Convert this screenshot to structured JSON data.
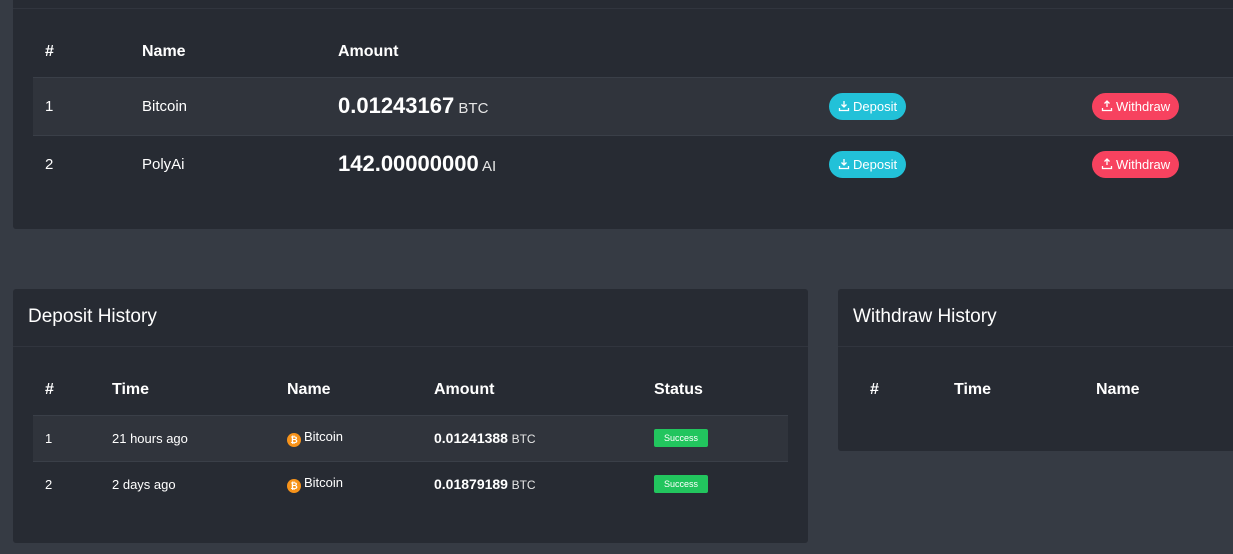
{
  "wallet": {
    "headers": {
      "num": "#",
      "name": "Name",
      "amount": "Amount"
    },
    "rows": [
      {
        "num": "1",
        "name": "Bitcoin",
        "amount": "0.01243167",
        "unit": "BTC",
        "deposit_label": "Deposit",
        "withdraw_label": "Withdraw"
      },
      {
        "num": "2",
        "name": "PolyAi",
        "amount": "142.00000000",
        "unit": "AI",
        "deposit_label": "Deposit",
        "withdraw_label": "Withdraw"
      }
    ],
    "icons": {
      "deposit": "download-icon",
      "withdraw": "upload-icon"
    }
  },
  "deposit_history": {
    "title": "Deposit History",
    "headers": {
      "num": "#",
      "time": "Time",
      "name": "Name",
      "amount": "Amount",
      "status": "Status"
    },
    "rows": [
      {
        "num": "1",
        "time": "21 hours ago",
        "name": "Bitcoin",
        "amount": "0.01241388",
        "unit": "BTC",
        "status": "Success"
      },
      {
        "num": "2",
        "time": "2 days ago",
        "name": "Bitcoin",
        "amount": "0.01879189",
        "unit": "BTC",
        "status": "Success"
      }
    ],
    "coin_icon": "bitcoin-icon"
  },
  "withdraw_history": {
    "title": "Withdraw History",
    "headers": {
      "num": "#",
      "time": "Time",
      "name": "Name"
    }
  },
  "colors": {
    "page_bg": "#363b44",
    "card_bg": "#272b33",
    "deposit_button": "#22c1d8",
    "withdraw_button": "#f7425f",
    "success_badge": "#22c55e",
    "bitcoin": "#f7931a"
  }
}
